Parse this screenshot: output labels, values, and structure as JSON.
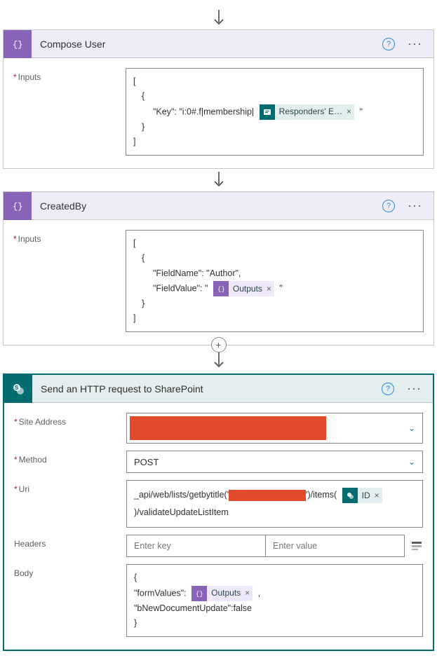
{
  "actions": {
    "compose_user": {
      "title": "Compose User",
      "label_inputs": "Inputs",
      "code": {
        "l1": "[",
        "l2": "{",
        "l3_pre": "\"Key\": \"i:0#.f|membership|",
        "token": "Responders' E…",
        "l3_post": "\"",
        "l4": "}",
        "l5": "]"
      }
    },
    "created_by": {
      "title": "CreatedBy",
      "label_inputs": "Inputs",
      "code": {
        "l1": "[",
        "l2": "{",
        "l3": "\"FieldName\": \"Author\",",
        "l4_pre": "\"FieldValue\": \"",
        "token": "Outputs",
        "l4_post": "\"",
        "l5": "}",
        "l6": "]"
      }
    },
    "http": {
      "title": "Send an HTTP request to SharePoint",
      "labels": {
        "site": "Site Address",
        "method": "Method",
        "uri": "Uri",
        "headers": "Headers",
        "body": "Body"
      },
      "method_value": "POST",
      "uri": {
        "pre": "_api/web/lists/getbytitle('",
        "mid": "')/items(",
        "token": "ID",
        "post": ")/validateUpdateListItem"
      },
      "headers_key_ph": "Enter key",
      "headers_val_ph": "Enter value",
      "body": {
        "l1": "{",
        "l2_pre": "\"formValues\":",
        "token": "Outputs",
        "l2_post": ",",
        "l3": "\"bNewDocumentUpdate\":false",
        "l4": "}"
      }
    }
  },
  "glyphs": {
    "help": "?",
    "dots": "···",
    "close": "×",
    "chev": "⌄",
    "plus": "+"
  }
}
